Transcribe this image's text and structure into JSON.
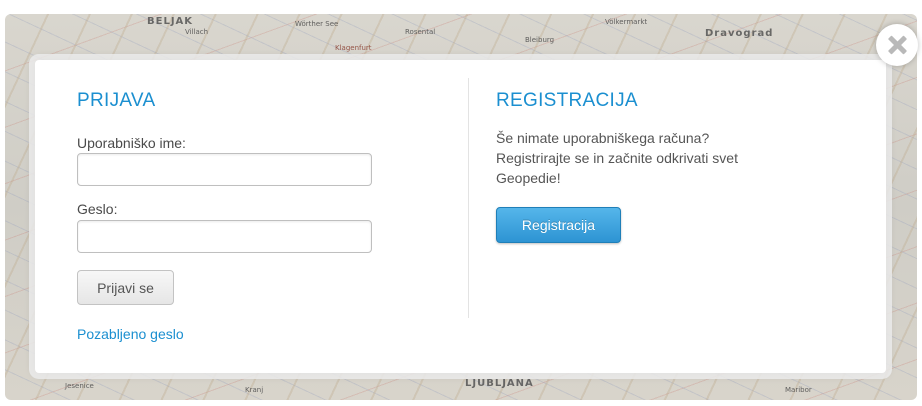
{
  "map": {
    "labels": [
      "BELJAK",
      "Villach",
      "Wörther See",
      "Klagenfurt",
      "Rosental",
      "Bleiburg",
      "Völkermarkt",
      "Dravograd",
      "Jesenice",
      "Kranj",
      "LJUBLJANA",
      "Maribor"
    ]
  },
  "login": {
    "heading": "PRIJAVA",
    "username_label": "Uporabniško ime:",
    "username_value": "",
    "password_label": "Geslo:",
    "password_value": "",
    "submit_label": "Prijavi se",
    "forgot_label": "Pozabljeno geslo"
  },
  "register": {
    "heading": "REGISTRACIJA",
    "description": "Še nimate uporabniškega računa? Registrirajte se in začnite odkrivati svet Geopedie!",
    "button_label": "Registracija"
  },
  "colors": {
    "accent": "#1b8fd0",
    "button_blue": "#2d94d3"
  },
  "icons": {
    "close": "close-icon"
  }
}
